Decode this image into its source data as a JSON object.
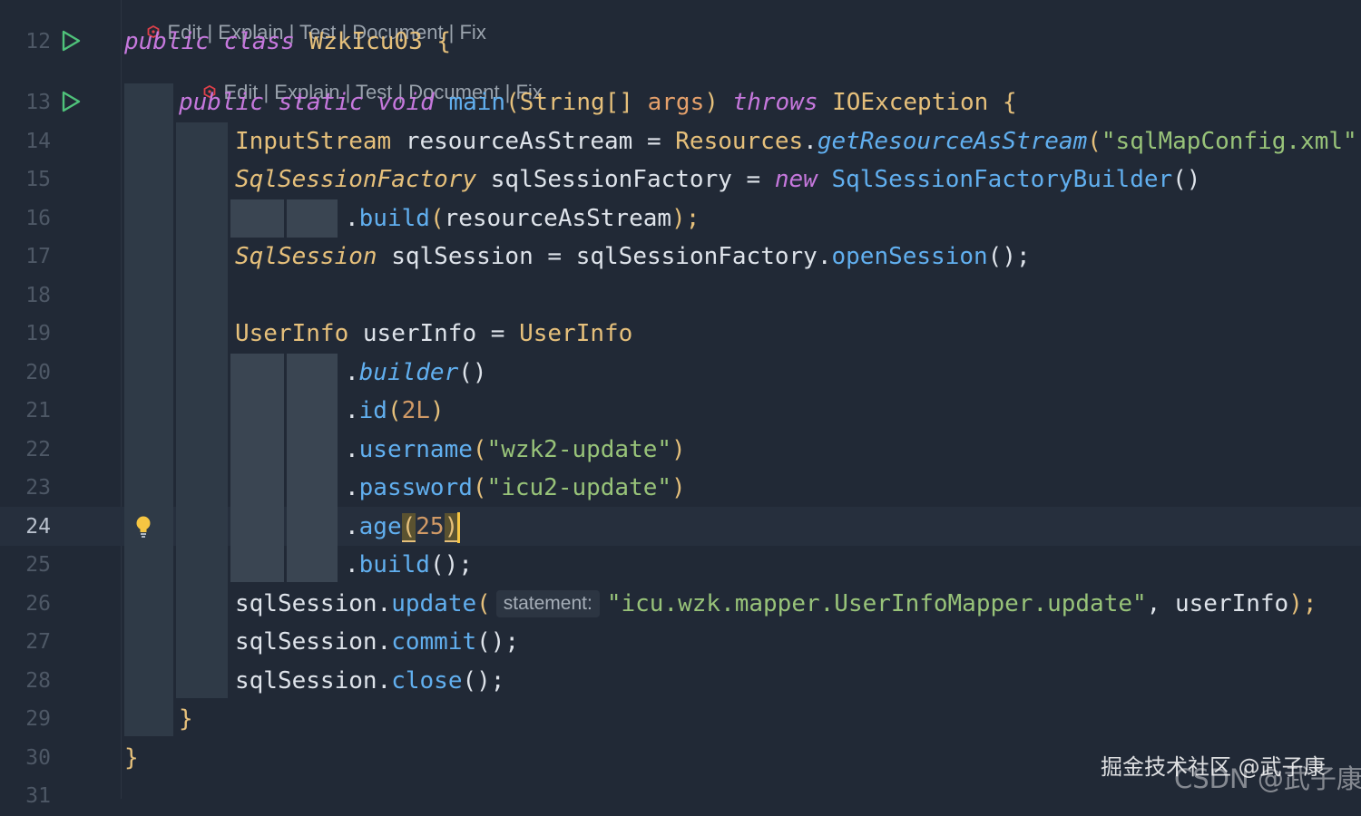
{
  "codelens": {
    "class_actions": "Edit | Explain | Test | Document | Fix",
    "method_actions": "Edit | Explain | Test | Document | Fix"
  },
  "line_numbers": [
    "12",
    "13",
    "14",
    "15",
    "16",
    "17",
    "18",
    "19",
    "20",
    "21",
    "22",
    "23",
    "24",
    "25",
    "26",
    "27",
    "28",
    "29",
    "30",
    "31"
  ],
  "active_line": "24",
  "code": {
    "l12": {
      "kw1": "public",
      "kw2": "class",
      "name": "WzkIcu03",
      "brace": "{"
    },
    "l13": {
      "kw1": "public",
      "kw2": "static",
      "kw3": "void",
      "fn": "main",
      "open": "(",
      "type": "String[]",
      "param": "args",
      "close": ")",
      "throws": "throws",
      "exc": "IOException",
      "brace": "{"
    },
    "l14": {
      "type": "InputStream",
      "var": "resourceAsStream",
      "eq": "=",
      "cls": "Resources",
      "dot": ".",
      "fn": "getResourceAsStream",
      "open": "(",
      "str": "\"sqlMapConfig.xml\"",
      "close": ");"
    },
    "l15": {
      "type": "SqlSessionFactory",
      "var": "sqlSessionFactory",
      "eq": "=",
      "kw": "new",
      "cls": "SqlSessionFactoryBuilder",
      "parens": "()"
    },
    "l16": {
      "dot": ".",
      "fn": "build",
      "open": "(",
      "arg": "resourceAsStream",
      "close": ");"
    },
    "l17": {
      "type": "SqlSession",
      "var": "sqlSession",
      "eq": "=",
      "obj": "sqlSessionFactory",
      "dot": ".",
      "fn": "openSession",
      "parens": "();"
    },
    "l19": {
      "type": "UserInfo",
      "var": "userInfo",
      "eq": "=",
      "cls": "UserInfo"
    },
    "l20": {
      "dot": ".",
      "fn": "builder",
      "parens": "()"
    },
    "l21": {
      "dot": ".",
      "fn": "id",
      "open": "(",
      "num": "2L",
      "close": ")"
    },
    "l22": {
      "dot": ".",
      "fn": "username",
      "open": "(",
      "str": "\"wzk2-update\"",
      "close": ")"
    },
    "l23": {
      "dot": ".",
      "fn": "password",
      "open": "(",
      "str": "\"icu2-update\"",
      "close": ")"
    },
    "l24": {
      "dot": ".",
      "fn": "age",
      "open": "(",
      "num": "25",
      "close": ")"
    },
    "l25": {
      "dot": ".",
      "fn": "build",
      "parens": "();"
    },
    "l26": {
      "obj": "sqlSession",
      "dot": ".",
      "fn": "update",
      "open": "(",
      "hint": "statement:",
      "str": "\"icu.wzk.mapper.UserInfoMapper.update\"",
      "comma": ",",
      "arg": "userInfo",
      "close": ");"
    },
    "l27": {
      "obj": "sqlSession",
      "dot": ".",
      "fn": "commit",
      "parens": "();"
    },
    "l28": {
      "obj": "sqlSession",
      "dot": ".",
      "fn": "close",
      "parens": "();"
    },
    "l29": {
      "brace": "}"
    },
    "l30": {
      "brace": "}"
    }
  },
  "watermark": {
    "line1": "掘金技术社区 @武子康",
    "line2": "CSDN @武子康"
  },
  "colors": {
    "background": "#212936",
    "keyword": "#c678dd",
    "type": "#e6c07b",
    "function": "#61afef",
    "string": "#98c379",
    "number": "#d19a66",
    "run_icon": "#4fc27a",
    "bulb": "#f5c542"
  },
  "icons": {
    "run": "run-triangle-icon",
    "bulb": "lightbulb-icon",
    "codelens": "ai-assistant-icon"
  }
}
